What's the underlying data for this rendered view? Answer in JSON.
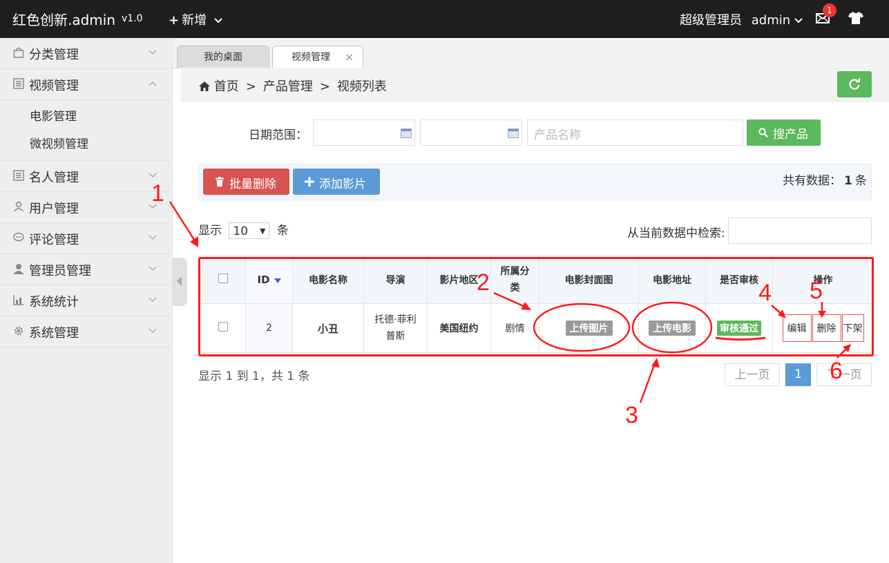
{
  "header": {
    "brand": "红色创新.admin",
    "version": "v1.0",
    "add_label": "新增",
    "user_label": "超级管理员",
    "username": "admin",
    "mail_badge": "1"
  },
  "sidebar": {
    "items": [
      {
        "label": "分类管理",
        "icon": "shopping-bag-icon",
        "expanded": false
      },
      {
        "label": "视频管理",
        "icon": "list-icon",
        "expanded": true,
        "children": [
          "电影管理",
          "微视频管理"
        ]
      },
      {
        "label": "名人管理",
        "icon": "list-icon",
        "expanded": false
      },
      {
        "label": "用户管理",
        "icon": "user-icon",
        "expanded": false
      },
      {
        "label": "评论管理",
        "icon": "comment-icon",
        "expanded": false
      },
      {
        "label": "管理员管理",
        "icon": "user-solid-icon",
        "expanded": false
      },
      {
        "label": "系统统计",
        "icon": "chart-icon",
        "expanded": false
      },
      {
        "label": "系统管理",
        "icon": "gear-icon",
        "expanded": false
      }
    ]
  },
  "tabs": [
    {
      "label": "我的桌面",
      "active": false
    },
    {
      "label": "视频管理",
      "active": true,
      "close": "×"
    }
  ],
  "breadcrumb": {
    "home": "首页",
    "sep": ">",
    "level1": "产品管理",
    "level2": "视频列表"
  },
  "filter": {
    "date_label": "日期范围：",
    "name_placeholder": "产品名称",
    "search_label": "搜产品"
  },
  "toolbar": {
    "batch_delete": "批量删除",
    "add_film": "添加影片",
    "total_prefix": "共有数据：",
    "total_count": "1",
    "total_suffix": "条"
  },
  "listing": {
    "show_prefix": "显示",
    "page_size": "10",
    "show_suffix": "条",
    "search_current_label": "从当前数据中检索:"
  },
  "table": {
    "columns": [
      "ID",
      "电影名称",
      "导演",
      "影片地区",
      "所属分类",
      "电影封面图",
      "电影地址",
      "是否审核",
      "操作"
    ],
    "rows": [
      {
        "id": "2",
        "name": "小丑",
        "director": "托德·菲利普斯",
        "region": "美国纽约",
        "category": "剧情",
        "cover": "上传图片",
        "url": "上传电影",
        "review": "审核通过",
        "ops": [
          "编辑",
          "删除",
          "下架"
        ]
      }
    ]
  },
  "pagination": {
    "info": "显示 1 到 1，共 1 条",
    "prev": "上一页",
    "current": "1",
    "next": "下一页"
  },
  "annotations": [
    "1",
    "2",
    "3",
    "4",
    "5",
    "6"
  ],
  "colors": {
    "accent_red": "#ff1a1a",
    "success": "#5cb85c",
    "danger": "#d9534f",
    "primary": "#5b9bd5",
    "topbar": "#1f1f1f"
  }
}
